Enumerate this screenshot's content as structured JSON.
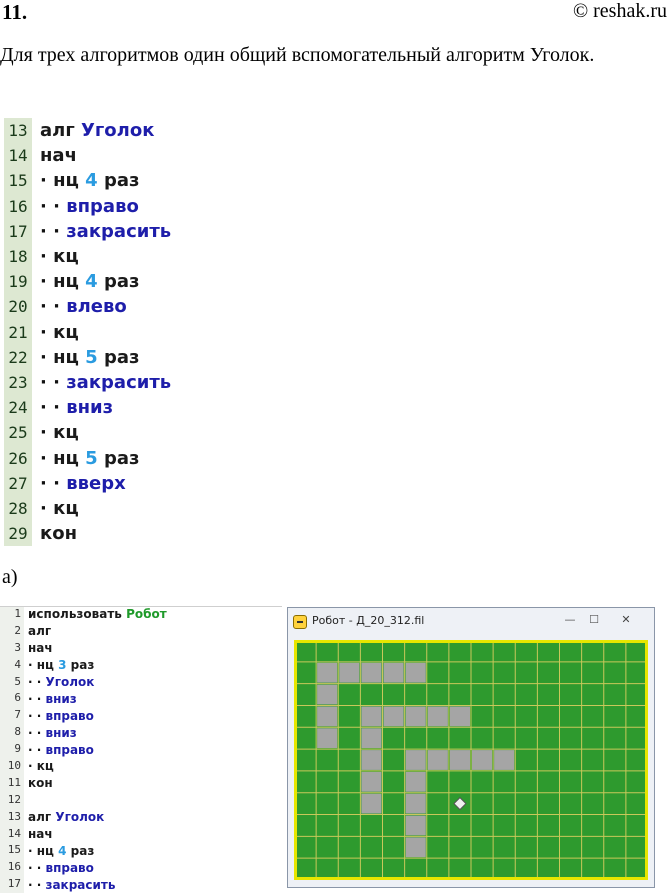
{
  "header": {
    "number": "11.",
    "source": "© reshak.ru"
  },
  "intro": "Для трех алгоритмов один общий вспомогательный алгоритм Уголок.",
  "listing_main": [
    {
      "n": "13",
      "parts": [
        [
          "kw",
          "алг "
        ],
        [
          "nm",
          "Уголок"
        ]
      ]
    },
    {
      "n": "14",
      "parts": [
        [
          "kw",
          "нач"
        ]
      ]
    },
    {
      "n": "15",
      "parts": [
        [
          "dot",
          "· "
        ],
        [
          "kw",
          "нц "
        ],
        [
          "num",
          "4"
        ],
        [
          "kw",
          " раз"
        ]
      ]
    },
    {
      "n": "16",
      "parts": [
        [
          "dot",
          "· · "
        ],
        [
          "nm",
          "вправо"
        ]
      ]
    },
    {
      "n": "17",
      "parts": [
        [
          "dot",
          "· · "
        ],
        [
          "nm",
          "закрасить"
        ]
      ]
    },
    {
      "n": "18",
      "parts": [
        [
          "dot",
          "· "
        ],
        [
          "kw",
          "кц"
        ]
      ]
    },
    {
      "n": "19",
      "parts": [
        [
          "dot",
          "· "
        ],
        [
          "kw",
          "нц "
        ],
        [
          "num",
          "4"
        ],
        [
          "kw",
          " раз"
        ]
      ]
    },
    {
      "n": "20",
      "parts": [
        [
          "dot",
          "· · "
        ],
        [
          "nm",
          "влево"
        ]
      ]
    },
    {
      "n": "21",
      "parts": [
        [
          "dot",
          "· "
        ],
        [
          "kw",
          "кц"
        ]
      ]
    },
    {
      "n": "22",
      "parts": [
        [
          "dot",
          "· "
        ],
        [
          "kw",
          "нц "
        ],
        [
          "num",
          "5"
        ],
        [
          "kw",
          " раз"
        ]
      ]
    },
    {
      "n": "23",
      "parts": [
        [
          "dot",
          "· · "
        ],
        [
          "nm",
          "закрасить"
        ]
      ]
    },
    {
      "n": "24",
      "parts": [
        [
          "dot",
          "· · "
        ],
        [
          "nm",
          "вниз"
        ]
      ]
    },
    {
      "n": "25",
      "parts": [
        [
          "dot",
          "· "
        ],
        [
          "kw",
          "кц"
        ]
      ]
    },
    {
      "n": "26",
      "parts": [
        [
          "dot",
          "· "
        ],
        [
          "kw",
          "нц "
        ],
        [
          "num",
          "5"
        ],
        [
          "kw",
          " раз"
        ]
      ]
    },
    {
      "n": "27",
      "parts": [
        [
          "dot",
          "· · "
        ],
        [
          "nm",
          "вверх"
        ]
      ]
    },
    {
      "n": "28",
      "parts": [
        [
          "dot",
          "· "
        ],
        [
          "kw",
          "кц"
        ]
      ]
    },
    {
      "n": "29",
      "parts": [
        [
          "kw",
          "кон"
        ]
      ]
    }
  ],
  "part_label": "а)",
  "listing_small": [
    {
      "n": "1",
      "parts": [
        [
          "kw",
          "использовать "
        ],
        [
          "grn",
          "Робот"
        ]
      ]
    },
    {
      "n": "2",
      "parts": [
        [
          "kw",
          "алг"
        ]
      ]
    },
    {
      "n": "3",
      "parts": [
        [
          "kw",
          "нач"
        ]
      ]
    },
    {
      "n": "4",
      "parts": [
        [
          "dot",
          "· "
        ],
        [
          "kw",
          "нц "
        ],
        [
          "num",
          "3"
        ],
        [
          "kw",
          " раз"
        ]
      ]
    },
    {
      "n": "5",
      "parts": [
        [
          "dot",
          "· · "
        ],
        [
          "nm",
          "Уголок"
        ]
      ]
    },
    {
      "n": "6",
      "parts": [
        [
          "dot",
          "· · "
        ],
        [
          "nm",
          "вниз"
        ]
      ]
    },
    {
      "n": "7",
      "parts": [
        [
          "dot",
          "· · "
        ],
        [
          "nm",
          "вправо"
        ]
      ]
    },
    {
      "n": "8",
      "parts": [
        [
          "dot",
          "· · "
        ],
        [
          "nm",
          "вниз"
        ]
      ]
    },
    {
      "n": "9",
      "parts": [
        [
          "dot",
          "· · "
        ],
        [
          "nm",
          "вправо"
        ]
      ]
    },
    {
      "n": "10",
      "parts": [
        [
          "dot",
          "· "
        ],
        [
          "kw",
          "кц"
        ]
      ]
    },
    {
      "n": "11",
      "parts": [
        [
          "kw",
          "кон"
        ]
      ]
    },
    {
      "n": "12",
      "parts": []
    },
    {
      "n": "13",
      "parts": [
        [
          "kw",
          "алг "
        ],
        [
          "nm",
          "Уголок"
        ]
      ]
    },
    {
      "n": "14",
      "parts": [
        [
          "kw",
          "нач"
        ]
      ]
    },
    {
      "n": "15",
      "parts": [
        [
          "dot",
          "· "
        ],
        [
          "kw",
          "нц "
        ],
        [
          "num",
          "4"
        ],
        [
          "kw",
          " раз"
        ]
      ]
    },
    {
      "n": "16",
      "parts": [
        [
          "dot",
          "· · "
        ],
        [
          "nm",
          "вправо"
        ]
      ]
    },
    {
      "n": "17",
      "parts": [
        [
          "dot",
          "· · "
        ],
        [
          "nm",
          "закрасить"
        ]
      ]
    }
  ],
  "robot_window": {
    "title": "Робот - Д_20_312.fil",
    "minimize": "—",
    "maximize": "☐",
    "close": "✕",
    "grid": {
      "cols": 16,
      "rows": 11
    },
    "colors": {
      "field": "#2e9a2e",
      "grid": "#c9c85a",
      "wall": "#e6e600",
      "painted": "#a5a5a5",
      "robot": "#f0f0f0"
    },
    "painted_cells": [
      [
        1,
        1
      ],
      [
        2,
        1
      ],
      [
        3,
        1
      ],
      [
        4,
        1
      ],
      [
        5,
        1
      ],
      [
        1,
        2
      ],
      [
        1,
        3
      ],
      [
        3,
        3
      ],
      [
        4,
        3
      ],
      [
        5,
        3
      ],
      [
        6,
        3
      ],
      [
        7,
        3
      ],
      [
        1,
        4
      ],
      [
        3,
        4
      ],
      [
        3,
        5
      ],
      [
        5,
        5
      ],
      [
        6,
        5
      ],
      [
        7,
        5
      ],
      [
        8,
        5
      ],
      [
        9,
        5
      ],
      [
        3,
        6
      ],
      [
        5,
        6
      ],
      [
        3,
        7
      ],
      [
        5,
        7
      ],
      [
        5,
        8
      ],
      [
        5,
        9
      ]
    ],
    "robot_cell": [
      7,
      7
    ]
  }
}
